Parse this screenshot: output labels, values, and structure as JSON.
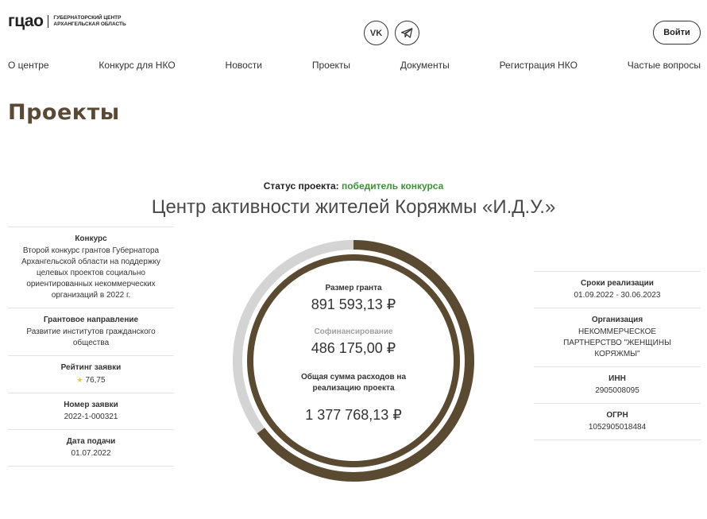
{
  "header": {
    "logo_mark": "гцао",
    "logo_line1": "Губернаторский центр",
    "logo_line2": "Архангельская область",
    "vk_icon": "vk-icon",
    "telegram_icon": "telegram-icon",
    "vk_label": "VK",
    "login_label": "Войти"
  },
  "nav": [
    "О центре",
    "Конкурс для НКО",
    "Новости",
    "Проекты",
    "Документы",
    "Регистрация НКО",
    "Частые вопросы"
  ],
  "page_title": "Проекты",
  "status": {
    "label": "Статус проекта:",
    "value": "победитель конкурса"
  },
  "project_name": "Центр активности жителей Коряжмы «И.Д.У.»",
  "left_info": [
    {
      "label": "Конкурс",
      "value": "Второй конкурс грантов Губернатора Архангельской области на поддержку целевых проектов социально ориентированных некоммерческих организаций в 2022 г."
    },
    {
      "label": "Грантовое направление",
      "value": "Развитие институтов гражданского общества"
    },
    {
      "label": "Рейтинг заявки",
      "value": "76,75"
    },
    {
      "label": "Номер заявки",
      "value": "2022-1-000321"
    },
    {
      "label": "Дата подачи",
      "value": "01.07.2022"
    }
  ],
  "right_info": [
    {
      "label": "Сроки реализации",
      "value": "01.09.2022 - 30.06.2023"
    },
    {
      "label": "Организация",
      "value": "НЕКОММЕРЧЕСКОЕ ПАРТНЕРСТВО \"ЖЕНЩИНЫ КОРЯЖМЫ\""
    },
    {
      "label": "ИНН",
      "value": "2905008095"
    },
    {
      "label": "ОГРН",
      "value": "1052905018484"
    }
  ],
  "finance": {
    "grant_label": "Размер гранта",
    "grant_value": "891 593,13 ₽",
    "cofin_label": "Софинансирование",
    "cofin_value": "486 175,00 ₽",
    "total_label": "Общая сумма расходов на реализацию проекта",
    "total_value": "1 377 768,13 ₽",
    "grant_share": 0.647,
    "colors": {
      "grant": "#5b4a32",
      "cofin": "#d4d4d4"
    }
  }
}
